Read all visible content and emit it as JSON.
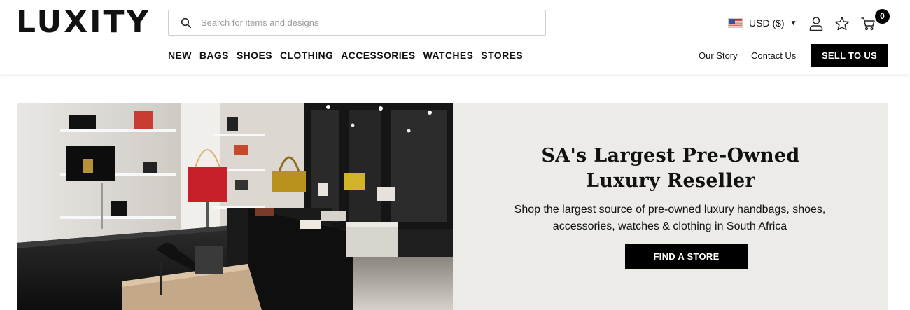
{
  "brand": {
    "logo_text": "LUXITY"
  },
  "search": {
    "placeholder": "Search for items and designs",
    "icon": "search-icon"
  },
  "currency": {
    "label": "USD ($)",
    "flag": "us-flag-icon"
  },
  "header_icons": {
    "account": "user-icon",
    "wishlist": "star-icon",
    "cart": "cart-icon",
    "cart_count": "0"
  },
  "main_nav": [
    {
      "label": "NEW"
    },
    {
      "label": "BAGS"
    },
    {
      "label": "SHOES"
    },
    {
      "label": "CLOTHING"
    },
    {
      "label": "ACCESSORIES"
    },
    {
      "label": "WATCHES"
    },
    {
      "label": "STORES"
    }
  ],
  "secondary_nav": {
    "our_story": "Our Story",
    "contact_us": "Contact Us",
    "sell_button": "SELL TO US"
  },
  "hero": {
    "title_line1": "SA's Largest Pre-Owned",
    "title_line2": "Luxury Reseller",
    "subtitle": "Shop the largest source of pre-owned luxury handbags, shoes, accessories, watches & clothing in South Africa",
    "cta": "FIND A STORE",
    "panel_color": "#ecebe7"
  },
  "colors": {
    "primary": "#000000",
    "text": "#111111",
    "panel": "#ecebe7"
  }
}
